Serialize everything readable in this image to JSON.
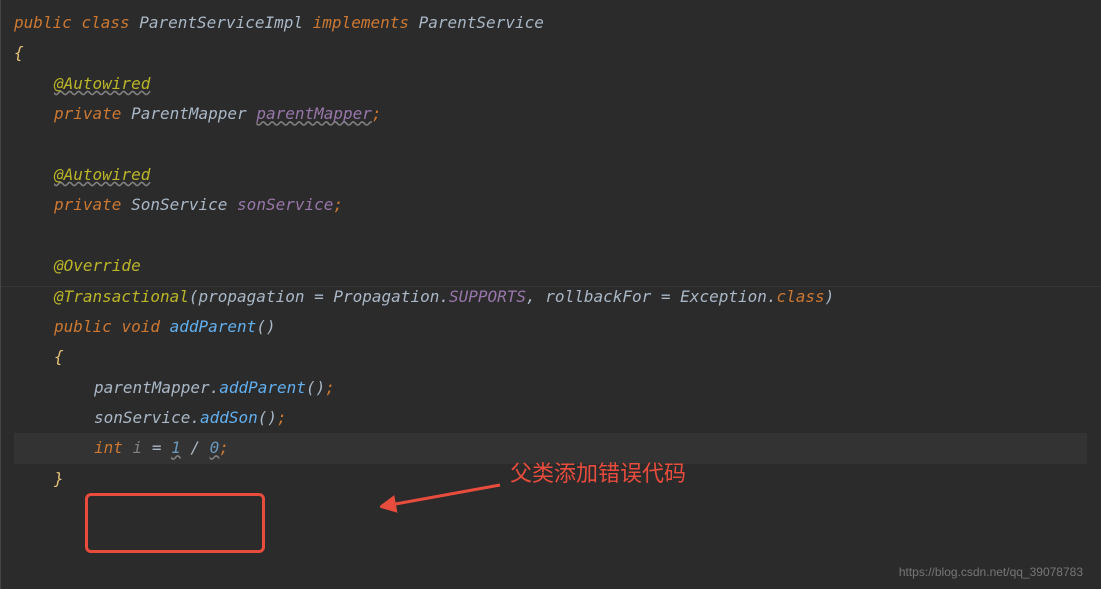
{
  "code": {
    "line1": {
      "public": "public",
      "class": "class",
      "className": "ParentServiceImpl",
      "implements": "implements",
      "interface": "ParentService"
    },
    "line2": "{",
    "line3": {
      "annotation": "@Autowired"
    },
    "line4": {
      "private": "private",
      "type": "ParentMapper",
      "varName": "parentMapper"
    },
    "line5": "",
    "line6": {
      "annotation": "@Autowired"
    },
    "line7": {
      "private": "private",
      "type": "SonService",
      "varName": "sonService"
    },
    "line8": "",
    "line9": {
      "annotation": "@Override"
    },
    "line10": {
      "annotation": "@Transactional",
      "open": "(",
      "param1": "propagation",
      "eq1": " = ",
      "prefix1": "Propagation.",
      "val1": "SUPPORTS",
      "comma": ", ",
      "param2": "rollbackFor",
      "eq2": " = ",
      "prefix2": "Exception.",
      "val2": "class",
      "close": ")"
    },
    "line11": {
      "public": "public",
      "void": "void",
      "method": "addParent",
      "parens": "()"
    },
    "line12": "{",
    "line13": {
      "obj": "parentMapper",
      "dot": ".",
      "method": "addParent",
      "parens": "()",
      "semi": ";"
    },
    "line14": {
      "obj": "sonService",
      "dot": ".",
      "method": "addSon",
      "parens": "()",
      "semi": ";"
    },
    "line15": {
      "int": "int",
      "var": "i",
      "eq": " = ",
      "num1": "1",
      "op": " / ",
      "num2": "0",
      "semi": ";"
    },
    "line16": "}"
  },
  "annotation": {
    "label": "父类添加错误代码"
  },
  "watermark": "https://blog.csdn.net/qq_39078783"
}
